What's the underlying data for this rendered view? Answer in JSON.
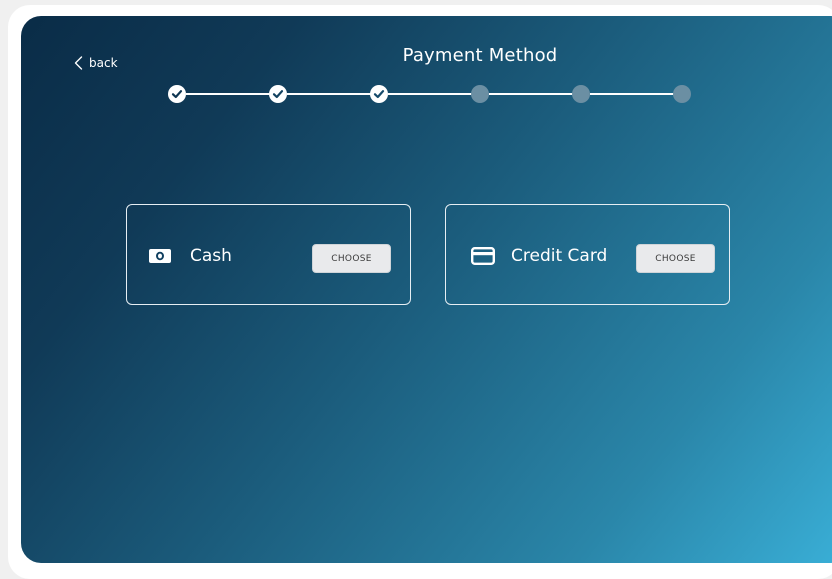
{
  "nav": {
    "back_label": "back"
  },
  "header": {
    "title": "Payment Method"
  },
  "stepper": {
    "steps": [
      {
        "state": "completed"
      },
      {
        "state": "completed"
      },
      {
        "state": "completed"
      },
      {
        "state": "pending"
      },
      {
        "state": "pending"
      },
      {
        "state": "pending"
      }
    ]
  },
  "options": [
    {
      "label": "Cash",
      "icon": "cash-icon",
      "button_label": "CHOOSE"
    },
    {
      "label": "Credit Card",
      "icon": "credit-card-icon",
      "button_label": "CHOOSE"
    }
  ],
  "colors": {
    "gradient_start": "#0a2c47",
    "gradient_end": "#3ab0d8",
    "step_done": "#ffffff",
    "step_pending": "#6b8fa3",
    "button_bg": "#e9eaec"
  }
}
